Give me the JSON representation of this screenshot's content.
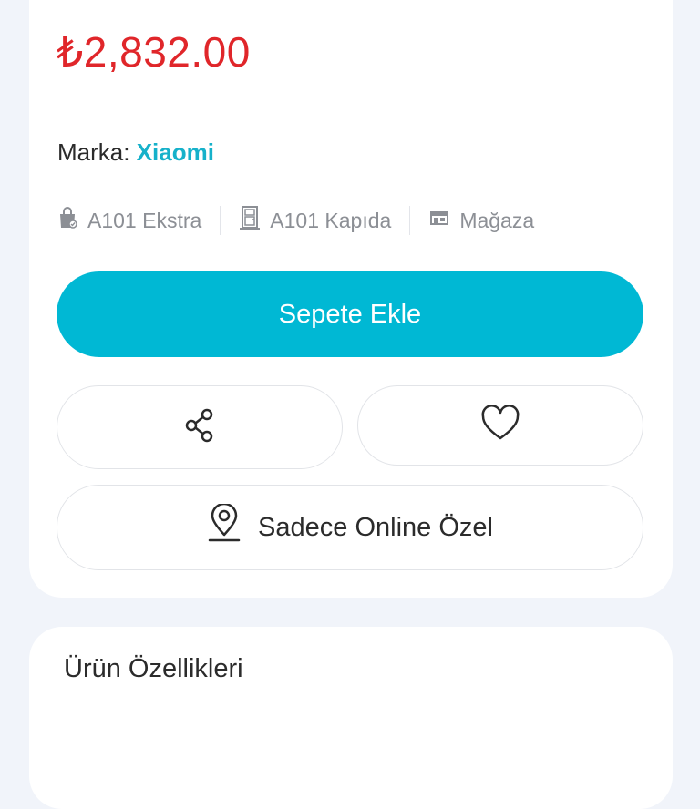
{
  "product": {
    "price": "₺2,832.00",
    "brand_label": "Marka:",
    "brand_name": "Xiaomi"
  },
  "delivery_options": [
    {
      "icon": "shopping-bag-icon",
      "label": "A101 Ekstra"
    },
    {
      "icon": "door-icon",
      "label": "A101 Kapıda"
    },
    {
      "icon": "store-icon",
      "label": "Mağaza"
    }
  ],
  "actions": {
    "add_to_cart": "Sepete Ekle",
    "share_icon": "share-icon",
    "favorite_icon": "heart-icon",
    "online_only_icon": "location-pin-icon",
    "online_only": "Sadece Online Özel"
  },
  "section": {
    "title": "Ürün Özellikleri"
  },
  "colors": {
    "price": "#e0262a",
    "accent": "#00b8d4",
    "brand": "#16b1ca",
    "background": "#f1f4fa"
  }
}
